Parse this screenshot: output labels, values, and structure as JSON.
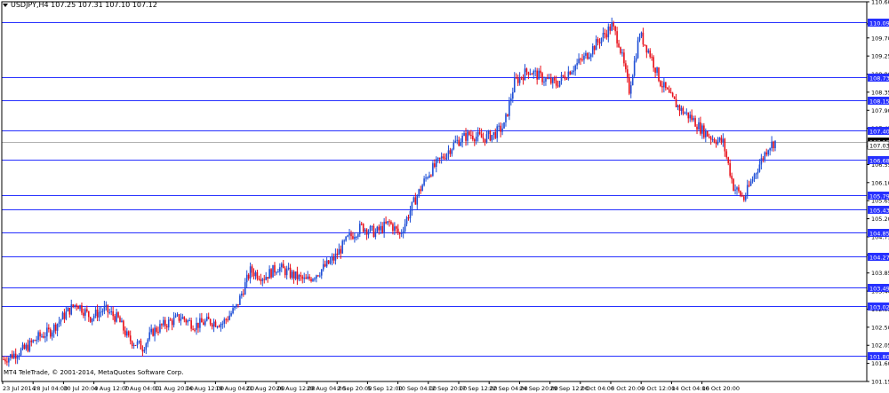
{
  "header": {
    "text": "USDJPY,H4  107.25 107.31 107.10 107.12"
  },
  "copyright": "MT4 TeleTrade, © 2001-2014, MetaQuotes Software Corp.",
  "colors": {
    "up": "#1f4fd6",
    "down": "#e8101a",
    "level": "#2630ff",
    "level_label_bg": "#2630ff",
    "axis": "#000000"
  },
  "chart_data": {
    "type": "candlestick",
    "symbol": "USDJPY",
    "timeframe": "H4",
    "ylim": [
      101.15,
      110.6
    ],
    "y_ticks": [
      "110.60",
      "110.05",
      "109.70",
      "109.25",
      "108.80",
      "108.35",
      "107.90",
      "107.45",
      "107.00",
      "106.55",
      "106.10",
      "105.65",
      "105.20",
      "104.75",
      "104.30",
      "103.85",
      "103.40",
      "102.95",
      "102.50",
      "102.05",
      "101.60",
      "101.15"
    ],
    "x_ticks": [
      "23 Jul 2014",
      "28 Jul 04:00",
      "30 Jul 20:00",
      "4 Aug 12:00",
      "7 Aug 04:00",
      "11 Aug 20:00",
      "14 Aug 12:00",
      "19 Aug 04:00",
      "21 Aug 20:00",
      "26 Aug 12:00",
      "29 Aug 04:00",
      "2 Sep 20:00",
      "5 Sep 12:00",
      "10 Sep 04:00",
      "12 Sep 20:00",
      "17 Sep 12:00",
      "22 Sep 04:00",
      "24 Sep 20:00",
      "29 Sep 12:00",
      "2 Oct 04:00",
      "6 Oct 20:00",
      "9 Oct 12:00",
      "14 Oct 04:00",
      "16 Oct 20:00"
    ],
    "levels": [
      110.09,
      108.73,
      108.15,
      107.4,
      106.68,
      105.79,
      105.43,
      104.85,
      104.27,
      103.49,
      103.02,
      101.8
    ],
    "level_labels": [
      "110.09",
      "108.73",
      "108.15",
      "107.40",
      "106.68",
      "105.79",
      "105.43",
      "104.85",
      "104.27",
      "103.49",
      "103.02",
      "101.80"
    ],
    "current_price_labels": [
      "107.12",
      "107.03"
    ],
    "close_anchors": [
      [
        0,
        101.7
      ],
      [
        12,
        101.95
      ],
      [
        20,
        102.25
      ],
      [
        27,
        102.4
      ],
      [
        36,
        102.85
      ],
      [
        42,
        103.1
      ],
      [
        50,
        102.75
      ],
      [
        58,
        102.95
      ],
      [
        66,
        102.7
      ],
      [
        72,
        102.2
      ],
      [
        80,
        102.0
      ],
      [
        86,
        102.4
      ],
      [
        94,
        102.6
      ],
      [
        102,
        102.75
      ],
      [
        110,
        102.55
      ],
      [
        118,
        102.65
      ],
      [
        126,
        102.6
      ],
      [
        134,
        103.0
      ],
      [
        142,
        103.9
      ],
      [
        150,
        103.75
      ],
      [
        158,
        104.0
      ],
      [
        166,
        103.8
      ],
      [
        174,
        103.65
      ],
      [
        182,
        103.9
      ],
      [
        190,
        104.2
      ],
      [
        198,
        104.7
      ],
      [
        206,
        105.0
      ],
      [
        214,
        104.85
      ],
      [
        222,
        105.1
      ],
      [
        228,
        104.8
      ],
      [
        236,
        105.6
      ],
      [
        244,
        106.3
      ],
      [
        252,
        106.7
      ],
      [
        260,
        107.1
      ],
      [
        268,
        107.3
      ],
      [
        276,
        107.2
      ],
      [
        282,
        107.3
      ],
      [
        288,
        107.5
      ],
      [
        294,
        108.6
      ],
      [
        302,
        108.9
      ],
      [
        310,
        108.7
      ],
      [
        318,
        108.55
      ],
      [
        326,
        108.9
      ],
      [
        334,
        109.2
      ],
      [
        342,
        109.6
      ],
      [
        350,
        110.0
      ],
      [
        354,
        109.6
      ],
      [
        360,
        108.4
      ],
      [
        366,
        109.8
      ],
      [
        372,
        109.3
      ],
      [
        378,
        108.6
      ],
      [
        384,
        108.2
      ],
      [
        390,
        107.9
      ],
      [
        396,
        107.7
      ],
      [
        402,
        107.4
      ],
      [
        408,
        107.2
      ],
      [
        414,
        107.1
      ],
      [
        420,
        106.0
      ],
      [
        426,
        105.7
      ],
      [
        432,
        106.3
      ],
      [
        440,
        107.0
      ],
      [
        444,
        107.12
      ]
    ]
  }
}
